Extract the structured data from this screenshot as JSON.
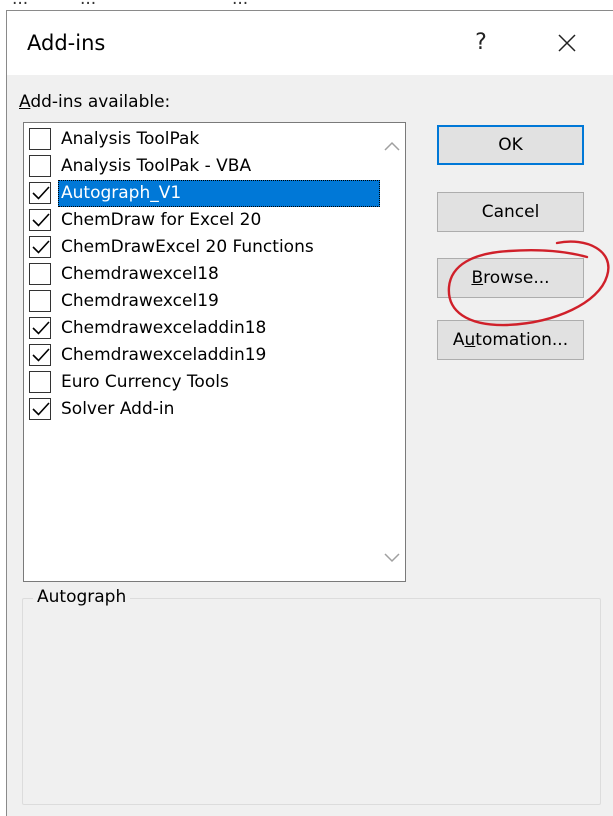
{
  "background": {
    "fragments": [
      "...",
      "...",
      "..."
    ]
  },
  "dialog": {
    "title": "Add-ins",
    "help_label": "?",
    "available_label_accel": "A",
    "available_label_rest": "dd-ins available:",
    "selected_description_title": "Autograph",
    "items": [
      {
        "label": "Analysis ToolPak",
        "checked": false
      },
      {
        "label": "Analysis ToolPak - VBA",
        "checked": false
      },
      {
        "label": "Autograph_V1",
        "checked": true,
        "selected": true
      },
      {
        "label": "ChemDraw for Excel 20",
        "checked": true
      },
      {
        "label": "ChemDrawExcel 20 Functions",
        "checked": true
      },
      {
        "label": "Chemdrawexcel18",
        "checked": false
      },
      {
        "label": "Chemdrawexcel19",
        "checked": false
      },
      {
        "label": "Chemdrawexceladdin18",
        "checked": true
      },
      {
        "label": "Chemdrawexceladdin19",
        "checked": true
      },
      {
        "label": "Euro Currency Tools",
        "checked": false
      },
      {
        "label": "Solver Add-in",
        "checked": true
      }
    ],
    "buttons": {
      "ok": "OK",
      "cancel": "Cancel",
      "browse_accel": "B",
      "browse_rest": "rowse...",
      "automation_pre": "A",
      "automation_accel": "u",
      "automation_rest": "tomation..."
    }
  },
  "colors": {
    "selection": "#0078d7",
    "annotation": "#d0202a",
    "dialog_bg": "#f0f0f0"
  }
}
